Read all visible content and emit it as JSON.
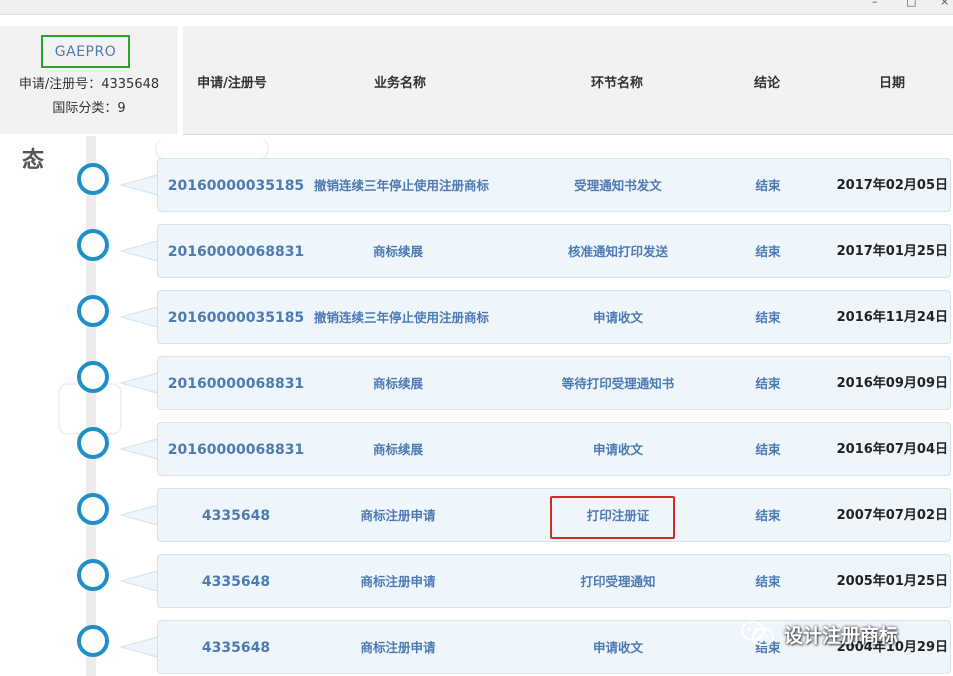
{
  "window": {
    "minimize": "–",
    "maximize": "□",
    "close": "×"
  },
  "brand": {
    "name": "GAEPRO"
  },
  "meta": {
    "reg_line": "申请/注册号：4335648",
    "class_line": "国际分类：9"
  },
  "status_label": "态",
  "columns": {
    "number": "申请/注册号",
    "business": "业务名称",
    "step": "环节名称",
    "result": "结论",
    "date": "日期"
  },
  "rows": [
    {
      "number": "20160000035185",
      "business": "撤销连续三年停止使用注册商标",
      "step": "受理通知书发文",
      "result": "结束",
      "date": "2017年02月05日"
    },
    {
      "number": "20160000068831",
      "business": "商标续展",
      "step": "核准通知打印发送",
      "result": "结束",
      "date": "2017年01月25日"
    },
    {
      "number": "20160000035185",
      "business": "撤销连续三年停止使用注册商标",
      "step": "申请收文",
      "result": "结束",
      "date": "2016年11月24日"
    },
    {
      "number": "20160000068831",
      "business": "商标续展",
      "step": "等待打印受理通知书",
      "result": "结束",
      "date": "2016年09月09日"
    },
    {
      "number": "20160000068831",
      "business": "商标续展",
      "step": "申请收文",
      "result": "结束",
      "date": "2016年07月04日"
    },
    {
      "number": "4335648",
      "business": "商标注册申请",
      "step": "打印注册证",
      "result": "结束",
      "date": "2007年07月02日"
    },
    {
      "number": "4335648",
      "business": "商标注册申请",
      "step": "打印受理通知",
      "result": "结束",
      "date": "2005年01月25日"
    },
    {
      "number": "4335648",
      "business": "商标注册申请",
      "step": "申请收文",
      "result": "结束",
      "date": "2004年10月29日"
    }
  ],
  "watermark": {
    "text": "设计注册商标",
    "icon": "wechat-icon"
  },
  "colors": {
    "accent": "#1f8fc8",
    "link": "#4f7bb5",
    "highlight": "#d62b25",
    "brand_border": "#2ca52c"
  }
}
